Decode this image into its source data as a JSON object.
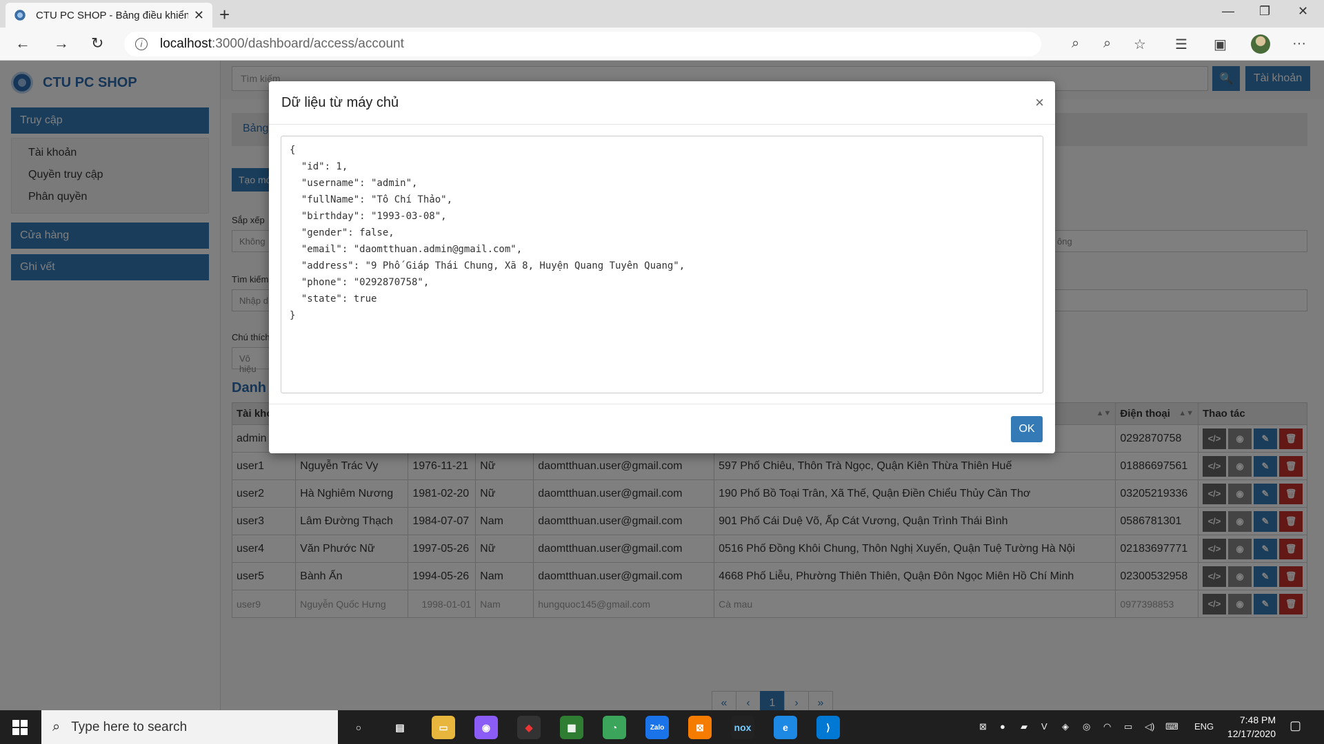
{
  "browser": {
    "tab_title": "CTU PC SHOP - Bảng điều khiển",
    "url_host": "localhost",
    "url_path": ":3000/dashboard/access/account"
  },
  "sidebar": {
    "brand": "CTU PC SHOP",
    "sections": [
      {
        "label": "Truy cập",
        "items": [
          "Tài khoản",
          "Quyền truy cập",
          "Phân quyền"
        ]
      },
      {
        "label": "Cửa hàng"
      },
      {
        "label": "Ghi vết"
      }
    ]
  },
  "header": {
    "search_placeholder": "Tìm kiếm",
    "account_label": "Tài khoản"
  },
  "panel": {
    "breadcrumb": "Bảng",
    "new_button": "Tạo mới",
    "sort_label": "Sắp xếp",
    "sort_value": "Không",
    "sort_value_right": "ông",
    "search_label": "Tìm kiếm",
    "search_placeholder": "Nhập d",
    "note_label": "Chú thích",
    "note_value": "Vô hiệu",
    "list_title": "Danh"
  },
  "table": {
    "headers": [
      "Tài kho",
      "",
      "",
      "",
      "",
      "",
      "Điện thoại",
      "Thao tác"
    ],
    "rows": [
      {
        "username": "admin",
        "fullname": "",
        "birthday": "",
        "gender": "",
        "email": "",
        "address": "",
        "phone": "0292870758",
        "dim": false
      },
      {
        "username": "user1",
        "fullname": "Nguyễn Trác Vy",
        "birthday": "1976-11-21",
        "gender": "Nữ",
        "email": "daomtthuan.user@gmail.com",
        "address": "597 Phố Chiêu, Thôn Trà Ngọc, Quận Kiên Thừa Thiên Huế",
        "phone": "01886697561",
        "dim": false
      },
      {
        "username": "user2",
        "fullname": "Hà Nghiêm Nương",
        "birthday": "1981-02-20",
        "gender": "Nữ",
        "email": "daomtthuan.user@gmail.com",
        "address": "190 Phố Bồ Toại Trân, Xã Thế, Quận Điền Chiểu Thủy Cần Thơ",
        "phone": "03205219336",
        "dim": false
      },
      {
        "username": "user3",
        "fullname": "Lâm Đường Thạch",
        "birthday": "1984-07-07",
        "gender": "Nam",
        "email": "daomtthuan.user@gmail.com",
        "address": "901 Phố Cái Duệ Võ, Ấp Cát Vương, Quận Trình Thái Bình",
        "phone": "0586781301",
        "dim": false
      },
      {
        "username": "user4",
        "fullname": "Văn Phước Nữ",
        "birthday": "1997-05-26",
        "gender": "Nữ",
        "email": "daomtthuan.user@gmail.com",
        "address": "0516 Phố Đồng Khôi Chung, Thôn Nghị Xuyến, Quận Tuệ Tường Hà Nội",
        "phone": "02183697771",
        "dim": false
      },
      {
        "username": "user5",
        "fullname": "Bành Ẩn",
        "birthday": "1994-05-26",
        "gender": "Nam",
        "email": "daomtthuan.user@gmail.com",
        "address": "4668 Phố Liễu, Phường Thiên Thiên, Quận Đôn Ngọc Miên Hồ Chí Minh",
        "phone": "02300532958",
        "dim": false
      },
      {
        "username": "user9",
        "fullname": "Nguyễn Quốc Hưng",
        "birthday": "1998-01-01",
        "gender": "Nam",
        "email": "hungquoc145@gmail.com",
        "address": "Cà mau",
        "phone": "0977398853",
        "dim": true
      }
    ]
  },
  "pagination": {
    "first": "«",
    "prev": "‹",
    "current": "1",
    "next": "›",
    "last": "»"
  },
  "modal": {
    "title": "Dữ liệu từ máy chủ",
    "close": "×",
    "content": "{\n  \"id\": 1,\n  \"username\": \"admin\",\n  \"fullName\": \"Tô Chí Thảo\",\n  \"birthday\": \"1993-03-08\",\n  \"gender\": false,\n  \"email\": \"daomtthuan.admin@gmail.com\",\n  \"address\": \"9 Phố Giáp Thái Chung, Xã 8, Huyện Quang Tuyên Quang\",\n  \"phone\": \"0292870758\",\n  \"state\": true\n}",
    "ok": "OK"
  },
  "taskbar": {
    "search_placeholder": "Type here to search",
    "language": "ENG",
    "time": "7:48 PM",
    "date": "12/17/2020"
  },
  "colors": {
    "primary": "#337ab7",
    "danger": "#c9302c"
  }
}
